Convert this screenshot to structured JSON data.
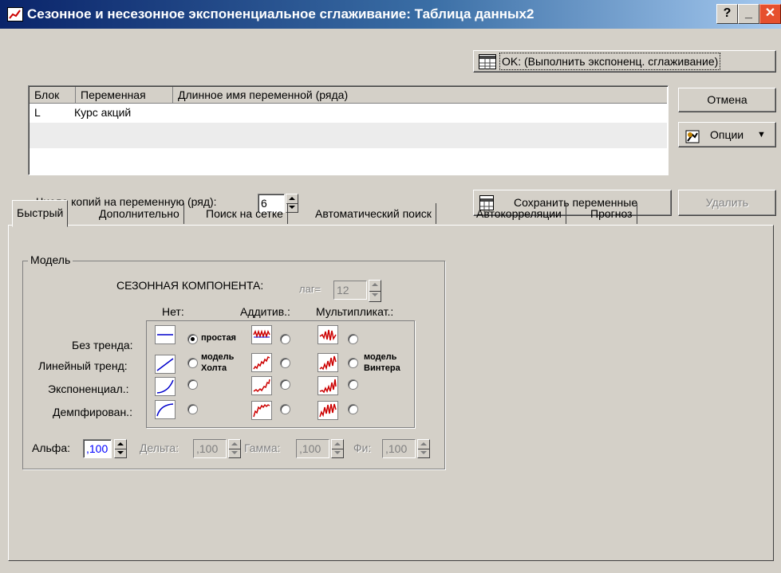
{
  "window": {
    "title": "Сезонное и несезонное экспоненциальное сглаживание: Таблица данных2",
    "help_label": "?",
    "minimize_label": "_",
    "close_label": "✕"
  },
  "buttons": {
    "ok": "OK: (Выполнить экспоненц. сглаживание)",
    "cancel": "Отмена",
    "options": "Опции",
    "save_vars": "Сохранить переменные",
    "delete": "Удалить"
  },
  "variables_list": {
    "headers": [
      "Блок",
      "Переменная",
      "Длинное имя переменной (ряда)"
    ],
    "rows": [
      {
        "block": "L",
        "variable": "Курс акций",
        "long_name": ""
      }
    ]
  },
  "copies": {
    "label": "Число копий на переменную (ряд):",
    "value": "6"
  },
  "tabs": [
    "Быстрый",
    "Дополнительно",
    "Поиск на сетке",
    "Автоматический поиск",
    "Автокорреляции",
    "Прогноз"
  ],
  "active_tab": "Быстрый",
  "model": {
    "group_title": "Модель",
    "seasonal_component": "СЕЗОННАЯ КОМПОНЕНТА:",
    "lag_label": "лаг=",
    "lag_value": "12",
    "col_none": "Нет:",
    "col_additive": "Аддитив.:",
    "col_multiplicative": "Мультипликат.:",
    "rows": [
      "Без тренда:",
      "Линейный тренд:",
      "Экспоненциал.:",
      "Демпфирован.:"
    ],
    "simple_label": "простая",
    "holt_label_1": "модель",
    "holt_label_2": "Холта",
    "winters_label_1": "модель",
    "winters_label_2": "Винтера",
    "selected": "simple"
  },
  "params": {
    "alpha_label": "Альфа:",
    "alpha_value": ",100",
    "delta_label": "Дельта:",
    "delta_value": ",100",
    "gamma_label": "Гамма:",
    "gamma_value": ",100",
    "phi_label": "Фи:",
    "phi_value": ",100"
  },
  "colors": {
    "title_gradient_start": "#0a246a",
    "title_gradient_end": "#a6caf0",
    "dialog_face": "#d4d0c8",
    "chart_line": "#0000cc",
    "seasonal_line": "#cc0000"
  }
}
